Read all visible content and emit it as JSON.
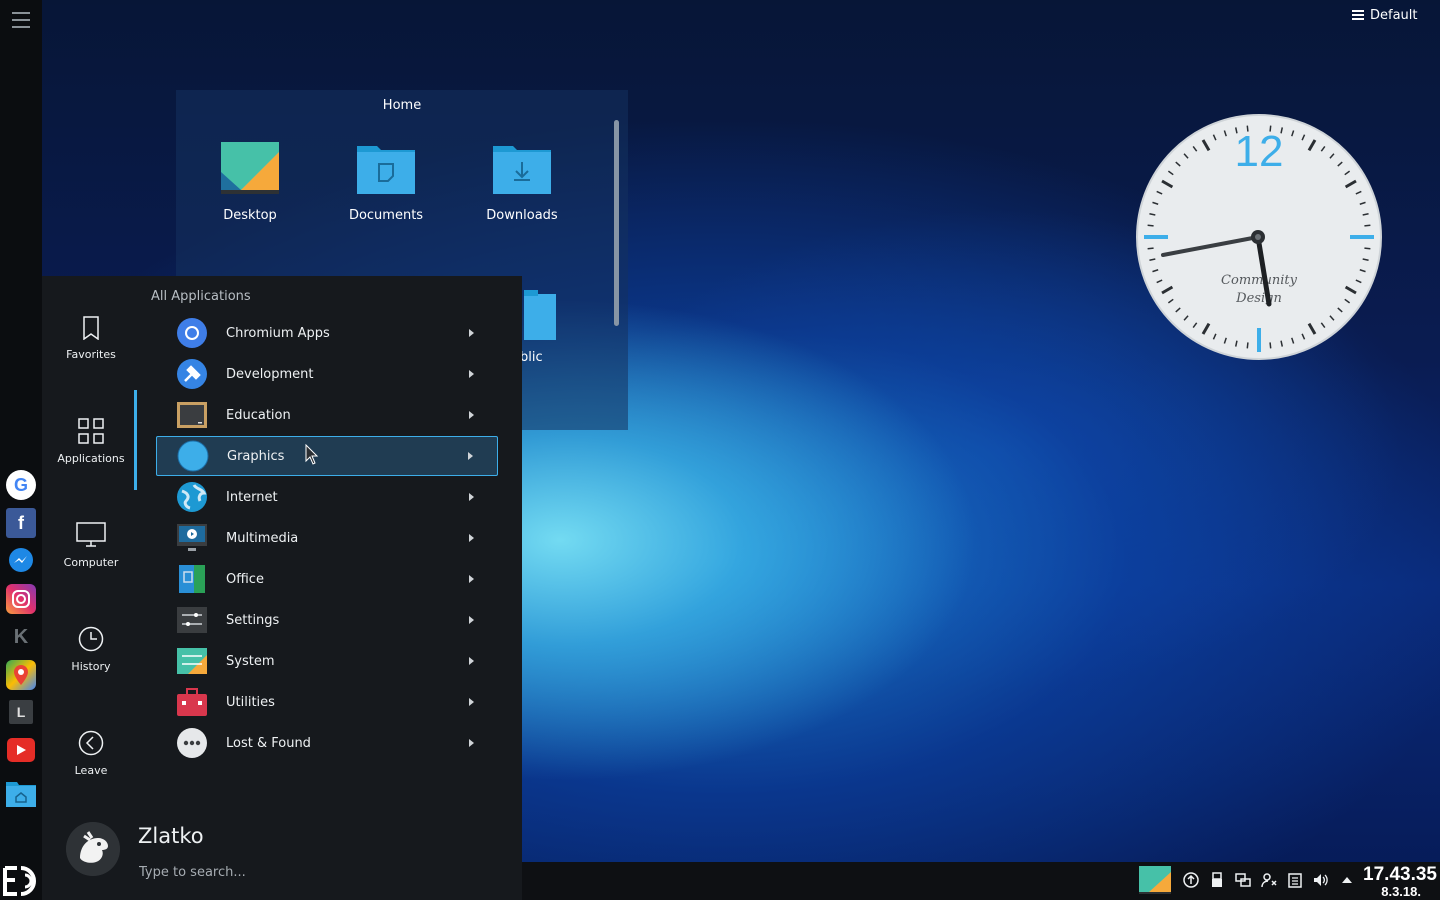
{
  "desktop": {
    "activity_label": "Default",
    "folder_view": {
      "title": "Home",
      "items": [
        {
          "label": "Desktop"
        },
        {
          "label": "Documents"
        },
        {
          "label": "Downloads"
        },
        {
          "label": "blic"
        }
      ]
    },
    "clock_widget": {
      "hour_label": "12",
      "brand_line1": "Community",
      "brand_line2": "Design",
      "accent_color": "#3daee9"
    }
  },
  "left_dock": {
    "apps": [
      {
        "icon": "google-icon"
      },
      {
        "icon": "facebook-icon"
      },
      {
        "icon": "messenger-icon"
      },
      {
        "icon": "instagram-icon"
      },
      {
        "icon": "kde-icon"
      },
      {
        "icon": "google-maps-icon"
      },
      {
        "icon": "l-app-icon",
        "label": "L"
      },
      {
        "icon": "youtube-icon"
      },
      {
        "icon": "home-folder-icon"
      }
    ]
  },
  "launcher": {
    "categories": [
      {
        "label": "Favorites",
        "icon": "bookmark-icon"
      },
      {
        "label": "Applications",
        "icon": "grid-icon",
        "active": true
      },
      {
        "label": "Computer",
        "icon": "monitor-icon"
      },
      {
        "label": "History",
        "icon": "clock-icon"
      },
      {
        "label": "Leave",
        "icon": "back-circle-icon"
      }
    ],
    "section_title": "All Applications",
    "apps": [
      {
        "label": "Chromium Apps",
        "icon": "chromium-icon"
      },
      {
        "label": "Development",
        "icon": "development-icon"
      },
      {
        "label": "Education",
        "icon": "education-icon"
      },
      {
        "label": "Graphics",
        "icon": "graphics-icon",
        "selected": true
      },
      {
        "label": "Internet",
        "icon": "internet-icon"
      },
      {
        "label": "Multimedia",
        "icon": "multimedia-icon"
      },
      {
        "label": "Office",
        "icon": "office-icon"
      },
      {
        "label": "Settings",
        "icon": "settings-icon"
      },
      {
        "label": "System",
        "icon": "system-icon"
      },
      {
        "label": "Utilities",
        "icon": "utilities-icon"
      },
      {
        "label": "Lost & Found",
        "icon": "lost-found-icon"
      }
    ],
    "user": {
      "name": "Zlatko"
    },
    "search": {
      "placeholder": "Type to search..."
    }
  },
  "taskbar": {
    "time": "17.43.35",
    "date": "8.3.18."
  }
}
